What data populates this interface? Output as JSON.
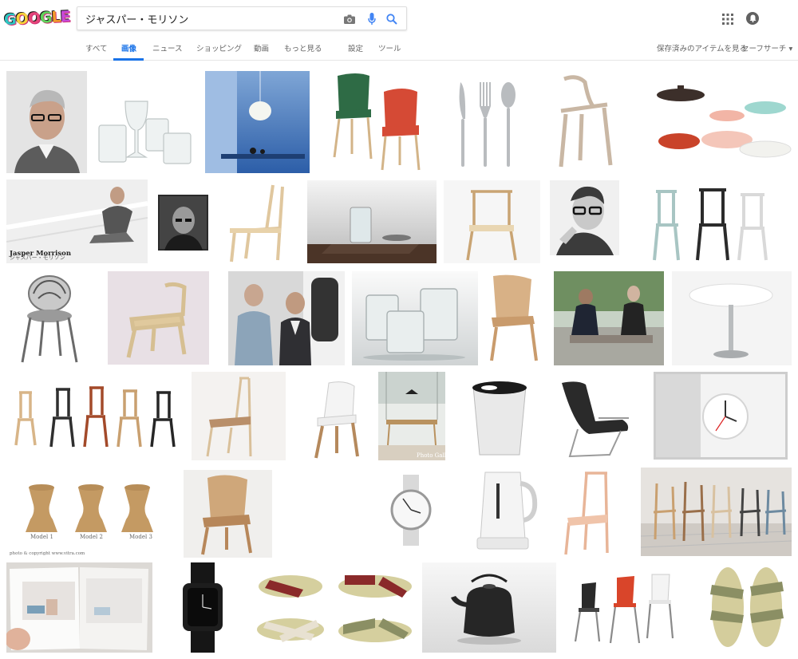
{
  "search": {
    "query": "ジャスパー・モリソン"
  },
  "tabs": [
    {
      "label": "すべて"
    },
    {
      "label": "画像"
    },
    {
      "label": "ニュース"
    },
    {
      "label": "ショッピング"
    },
    {
      "label": "動画"
    },
    {
      "label": "もっと見る"
    },
    {
      "label": "設定"
    },
    {
      "label": "ツール"
    }
  ],
  "right_links": {
    "saved": "保存済みのアイテムを見る",
    "safesearch": "セーフサーチ ▾"
  },
  "captions": {
    "jasper_title": "Jasper Morrison",
    "jasper_sub": "ジャスパー・モリソン",
    "photo_gallery": "Photo Gallery",
    "cork_models": [
      "Model 1",
      "Model 2",
      "Model 3"
    ],
    "cork_copyright": "photo & copyright www.vitra.com"
  },
  "colors": {
    "accent": "#1a73e8",
    "tab_text": "#666666"
  }
}
